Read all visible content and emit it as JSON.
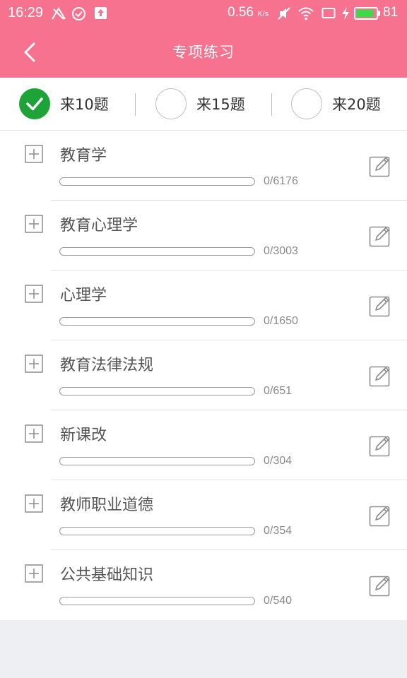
{
  "status_bar": {
    "time": "16:29",
    "net_speed_value": "0.56",
    "net_speed_unit": "K/s",
    "battery_level": "81",
    "icons": [
      "network-icon",
      "sync-icon",
      "upload-icon",
      "mute-icon",
      "wifi-icon",
      "screen-icon",
      "charging-icon",
      "battery-icon"
    ]
  },
  "header": {
    "title": "专项练习",
    "back_icon": "chevron-left-icon",
    "color": "#f7728f"
  },
  "question_count": {
    "options": [
      {
        "label": "来10题",
        "selected": true
      },
      {
        "label": "来15题",
        "selected": false
      },
      {
        "label": "来20题",
        "selected": false
      }
    ],
    "selected_color": "#1ea338"
  },
  "subjects": [
    {
      "name": "教育学",
      "done": 0,
      "total": 6176,
      "count_text": "0/6176"
    },
    {
      "name": "教育心理学",
      "done": 0,
      "total": 3003,
      "count_text": "0/3003"
    },
    {
      "name": "心理学",
      "done": 0,
      "total": 1650,
      "count_text": "0/1650"
    },
    {
      "name": "教育法律法规",
      "done": 0,
      "total": 651,
      "count_text": "0/651"
    },
    {
      "name": "新课改",
      "done": 0,
      "total": 304,
      "count_text": "0/304"
    },
    {
      "name": "教师职业道德",
      "done": 0,
      "total": 354,
      "count_text": "0/354"
    },
    {
      "name": "公共基础知识",
      "done": 0,
      "total": 540,
      "count_text": "0/540"
    }
  ],
  "item_icons": {
    "expand": "plus-square-icon",
    "practice": "edit-icon"
  }
}
